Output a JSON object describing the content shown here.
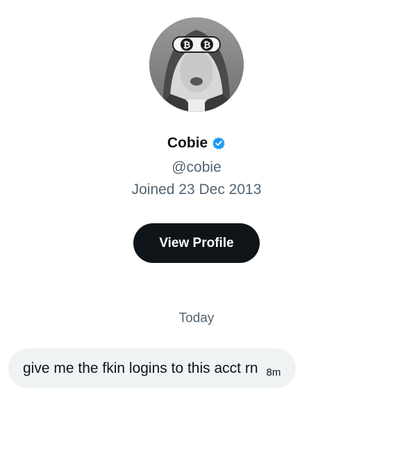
{
  "profile": {
    "display_name": "Cobie",
    "handle": "@cobie",
    "joined": "Joined 23 Dec 2013",
    "view_profile_label": "View Profile",
    "verified_color": "#1d9bf0"
  },
  "conversation": {
    "date_separator": "Today",
    "messages": [
      {
        "text": "give me the fkin logins to this acct rn",
        "time": "8m"
      }
    ]
  },
  "icons": {
    "verified": "verified-badge-icon",
    "avatar_glasses_symbol": "₿"
  }
}
